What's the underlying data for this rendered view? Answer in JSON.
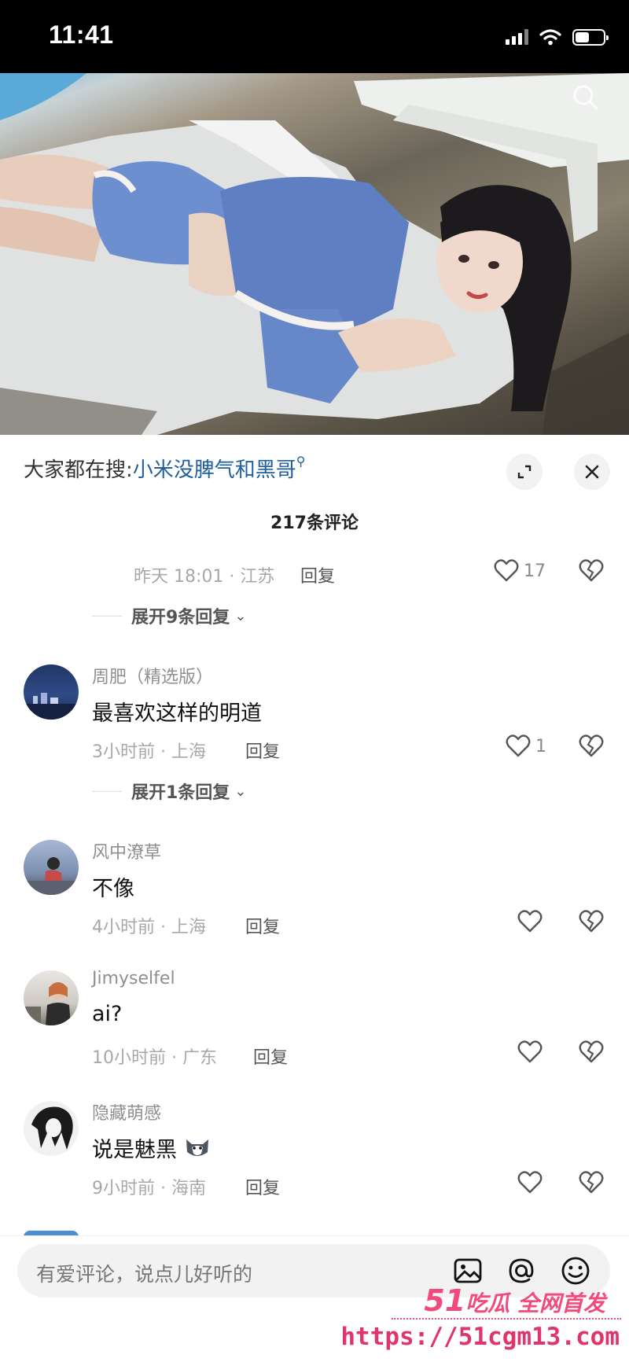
{
  "status_bar": {
    "time": "11:41",
    "icons": [
      "signal-icon",
      "wifi-icon",
      "battery-icon"
    ]
  },
  "header": {
    "search_prefix": "大家都在搜:",
    "search_keyword": "小米没脾气和黑哥",
    "comment_count": "217条评论",
    "icons": [
      "search-icon",
      "expand-icon",
      "close-icon"
    ]
  },
  "comments": [
    {
      "meta": "昨天 18:01 · 江苏",
      "reply_label": "回复",
      "likes": "17",
      "expand_label": "展开9条回复"
    },
    {
      "username": "周肥（精选版）",
      "text": "最喜欢这样的明道",
      "meta": "3小时前 · 上海",
      "reply_label": "回复",
      "likes": "1",
      "expand_label": "展开1条回复"
    },
    {
      "username": "风中潦草",
      "text": "不像",
      "meta": "4小时前 · 上海",
      "reply_label": "回复",
      "likes": ""
    },
    {
      "username": "Jimyselfel",
      "text": "ai?",
      "meta": "10小时前 · 广东",
      "reply_label": "回复",
      "likes": ""
    },
    {
      "username": "隐藏萌感",
      "text": "说是魅黑",
      "meta": "9小时前 · 海南",
      "reply_label": "回复",
      "likes": ""
    }
  ],
  "input": {
    "placeholder": "有爱评论，说点儿好听的",
    "icons": [
      "image-icon",
      "at-icon",
      "emoji-icon"
    ]
  },
  "watermark": {
    "line1_num": "51",
    "line1_text": "吃瓜 全网首发",
    "line2": "https://51cgm13.com"
  },
  "colors": {
    "keyword": "#1f5f9e",
    "watermark": "#f24a7a"
  }
}
